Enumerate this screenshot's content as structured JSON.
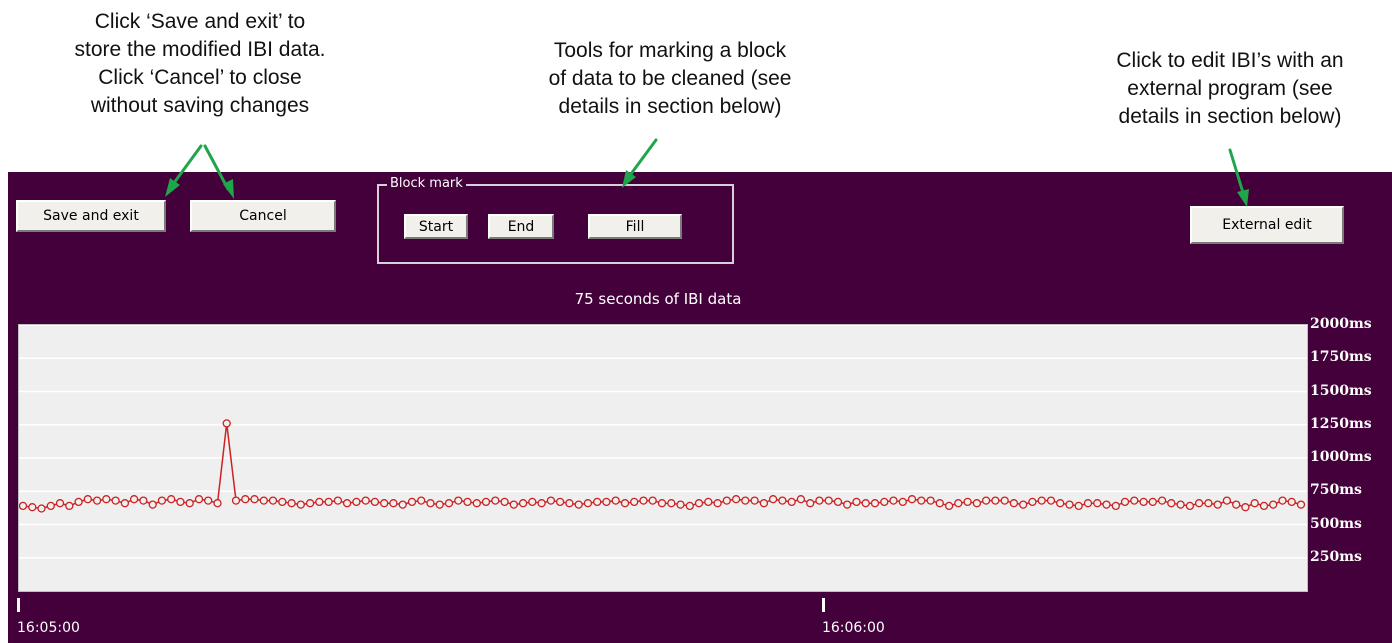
{
  "annotations": {
    "save_cancel": [
      "Click ‘Save and exit’ to",
      "store the modified IBI data.",
      "Click ‘Cancel’ to close",
      "without saving changes"
    ],
    "block_tools": [
      "Tools for marking a block",
      "of data to be cleaned (see",
      "details in section below)"
    ],
    "external": [
      "Click to edit IBI’s with an",
      "external program (see",
      "details in section below)"
    ]
  },
  "toolbar": {
    "save_label": "Save and exit",
    "cancel_label": "Cancel",
    "block_mark_label": "Block mark",
    "start_label": "Start",
    "end_label": "End",
    "fill_label": "Fill",
    "external_edit_label": "External edit"
  },
  "colors": {
    "background": "#43003a",
    "plot_background": "#efefef",
    "series_line": "#cc2222",
    "arrow": "#1fa54a"
  },
  "chart_data": {
    "type": "line",
    "title": "75 seconds of IBI data",
    "ylim": [
      0,
      2000
    ],
    "y_ticks": [
      {
        "value": 2000,
        "label": "2000ms"
      },
      {
        "value": 1750,
        "label": "1750ms"
      },
      {
        "value": 1500,
        "label": "1500ms"
      },
      {
        "value": 1250,
        "label": "1250ms"
      },
      {
        "value": 1000,
        "label": "1000ms"
      },
      {
        "value": 750,
        "label": "750ms"
      },
      {
        "value": 500,
        "label": "500ms"
      },
      {
        "value": 250,
        "label": "250ms"
      }
    ],
    "xlim": [
      0,
      75
    ],
    "x_ticks": [
      {
        "value": 0,
        "label": "16:05:00"
      },
      {
        "value": 60,
        "label": "16:06:00"
      }
    ],
    "grid": true,
    "series": [
      {
        "values": [
          640,
          630,
          620,
          640,
          660,
          640,
          670,
          690,
          680,
          690,
          680,
          660,
          690,
          680,
          650,
          680,
          690,
          670,
          660,
          690,
          680,
          660,
          1260,
          680,
          690,
          690,
          680,
          680,
          670,
          660,
          650,
          660,
          670,
          670,
          680,
          660,
          670,
          680,
          670,
          660,
          660,
          650,
          670,
          680,
          660,
          650,
          660,
          680,
          670,
          660,
          670,
          680,
          670,
          650,
          660,
          670,
          660,
          680,
          670,
          660,
          650,
          660,
          670,
          670,
          680,
          660,
          670,
          680,
          680,
          660,
          660,
          650,
          640,
          660,
          670,
          660,
          680,
          690,
          680,
          680,
          660,
          690,
          680,
          670,
          690,
          660,
          680,
          680,
          670,
          650,
          670,
          660,
          660,
          670,
          680,
          670,
          690,
          680,
          680,
          660,
          640,
          660,
          670,
          660,
          680,
          680,
          680,
          660,
          650,
          670,
          680,
          680,
          660,
          650,
          640,
          660,
          660,
          650,
          640,
          670,
          680,
          670,
          670,
          680,
          660,
          650,
          640,
          660,
          660,
          650,
          680,
          650,
          630,
          660,
          640,
          650,
          680,
          670,
          650
        ]
      }
    ]
  }
}
